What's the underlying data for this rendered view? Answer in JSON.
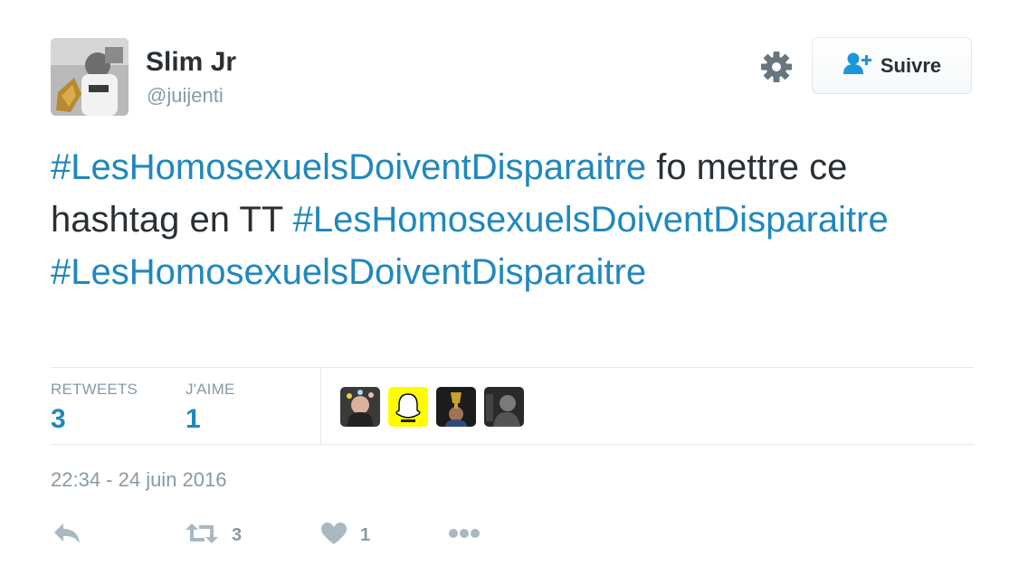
{
  "user": {
    "display_name": "Slim Jr",
    "handle": "@juijenti"
  },
  "header": {
    "settings_icon": "gear-icon",
    "follow_icon": "add-user-icon",
    "follow_label": "Suivre"
  },
  "tweet": {
    "segments": [
      {
        "text": "#LesHomosexuelsDoiventDisparaitre",
        "hashtag": true
      },
      {
        "text": " fo mettre ce hashtag en TT ",
        "hashtag": false
      },
      {
        "text": "#LesHomosexuelsDoiventDisparaitre",
        "hashtag": true
      },
      {
        "text": " ",
        "hashtag": false
      },
      {
        "text": "#LesHomosexuelsDoiventDisparaitre",
        "hashtag": true
      }
    ]
  },
  "stats": {
    "retweets_label": "RETWEETS",
    "retweets_value": "3",
    "likes_label": "J'AIME",
    "likes_value": "1"
  },
  "timestamp": "22:34 - 24 juin 2016",
  "actions": {
    "reply_icon": "reply-icon",
    "retweet_icon": "retweet-icon",
    "retweet_count": "3",
    "like_icon": "heart-icon",
    "like_count": "1",
    "more_icon": "more-icon"
  },
  "colors": {
    "link": "#1f88bd",
    "text": "#292f33",
    "muted": "#8899a6",
    "border": "#e1e8ed"
  }
}
